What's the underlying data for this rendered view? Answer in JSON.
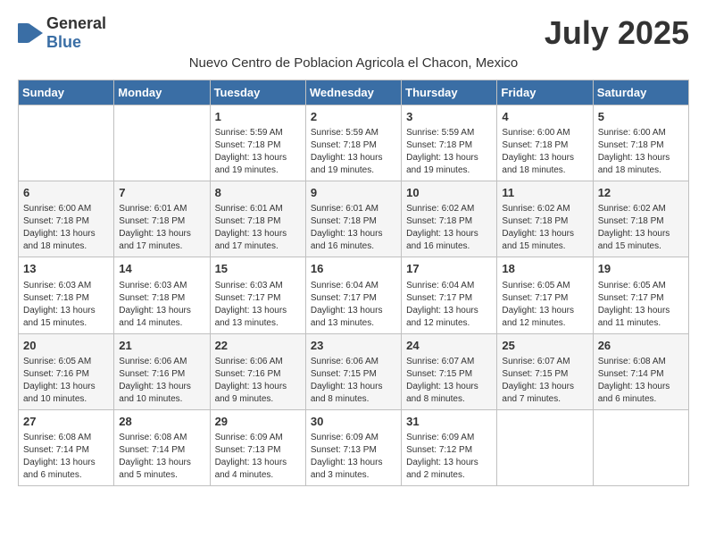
{
  "header": {
    "logo": {
      "general": "General",
      "blue": "Blue"
    },
    "month_title": "July 2025",
    "location": "Nuevo Centro de Poblacion Agricola el Chacon, Mexico"
  },
  "weekdays": [
    "Sunday",
    "Monday",
    "Tuesday",
    "Wednesday",
    "Thursday",
    "Friday",
    "Saturday"
  ],
  "weeks": [
    [
      {
        "day": "",
        "info": ""
      },
      {
        "day": "",
        "info": ""
      },
      {
        "day": "1",
        "info": "Sunrise: 5:59 AM\nSunset: 7:18 PM\nDaylight: 13 hours and 19 minutes."
      },
      {
        "day": "2",
        "info": "Sunrise: 5:59 AM\nSunset: 7:18 PM\nDaylight: 13 hours and 19 minutes."
      },
      {
        "day": "3",
        "info": "Sunrise: 5:59 AM\nSunset: 7:18 PM\nDaylight: 13 hours and 19 minutes."
      },
      {
        "day": "4",
        "info": "Sunrise: 6:00 AM\nSunset: 7:18 PM\nDaylight: 13 hours and 18 minutes."
      },
      {
        "day": "5",
        "info": "Sunrise: 6:00 AM\nSunset: 7:18 PM\nDaylight: 13 hours and 18 minutes."
      }
    ],
    [
      {
        "day": "6",
        "info": "Sunrise: 6:00 AM\nSunset: 7:18 PM\nDaylight: 13 hours and 18 minutes."
      },
      {
        "day": "7",
        "info": "Sunrise: 6:01 AM\nSunset: 7:18 PM\nDaylight: 13 hours and 17 minutes."
      },
      {
        "day": "8",
        "info": "Sunrise: 6:01 AM\nSunset: 7:18 PM\nDaylight: 13 hours and 17 minutes."
      },
      {
        "day": "9",
        "info": "Sunrise: 6:01 AM\nSunset: 7:18 PM\nDaylight: 13 hours and 16 minutes."
      },
      {
        "day": "10",
        "info": "Sunrise: 6:02 AM\nSunset: 7:18 PM\nDaylight: 13 hours and 16 minutes."
      },
      {
        "day": "11",
        "info": "Sunrise: 6:02 AM\nSunset: 7:18 PM\nDaylight: 13 hours and 15 minutes."
      },
      {
        "day": "12",
        "info": "Sunrise: 6:02 AM\nSunset: 7:18 PM\nDaylight: 13 hours and 15 minutes."
      }
    ],
    [
      {
        "day": "13",
        "info": "Sunrise: 6:03 AM\nSunset: 7:18 PM\nDaylight: 13 hours and 15 minutes."
      },
      {
        "day": "14",
        "info": "Sunrise: 6:03 AM\nSunset: 7:18 PM\nDaylight: 13 hours and 14 minutes."
      },
      {
        "day": "15",
        "info": "Sunrise: 6:03 AM\nSunset: 7:17 PM\nDaylight: 13 hours and 13 minutes."
      },
      {
        "day": "16",
        "info": "Sunrise: 6:04 AM\nSunset: 7:17 PM\nDaylight: 13 hours and 13 minutes."
      },
      {
        "day": "17",
        "info": "Sunrise: 6:04 AM\nSunset: 7:17 PM\nDaylight: 13 hours and 12 minutes."
      },
      {
        "day": "18",
        "info": "Sunrise: 6:05 AM\nSunset: 7:17 PM\nDaylight: 13 hours and 12 minutes."
      },
      {
        "day": "19",
        "info": "Sunrise: 6:05 AM\nSunset: 7:17 PM\nDaylight: 13 hours and 11 minutes."
      }
    ],
    [
      {
        "day": "20",
        "info": "Sunrise: 6:05 AM\nSunset: 7:16 PM\nDaylight: 13 hours and 10 minutes."
      },
      {
        "day": "21",
        "info": "Sunrise: 6:06 AM\nSunset: 7:16 PM\nDaylight: 13 hours and 10 minutes."
      },
      {
        "day": "22",
        "info": "Sunrise: 6:06 AM\nSunset: 7:16 PM\nDaylight: 13 hours and 9 minutes."
      },
      {
        "day": "23",
        "info": "Sunrise: 6:06 AM\nSunset: 7:15 PM\nDaylight: 13 hours and 8 minutes."
      },
      {
        "day": "24",
        "info": "Sunrise: 6:07 AM\nSunset: 7:15 PM\nDaylight: 13 hours and 8 minutes."
      },
      {
        "day": "25",
        "info": "Sunrise: 6:07 AM\nSunset: 7:15 PM\nDaylight: 13 hours and 7 minutes."
      },
      {
        "day": "26",
        "info": "Sunrise: 6:08 AM\nSunset: 7:14 PM\nDaylight: 13 hours and 6 minutes."
      }
    ],
    [
      {
        "day": "27",
        "info": "Sunrise: 6:08 AM\nSunset: 7:14 PM\nDaylight: 13 hours and 6 minutes."
      },
      {
        "day": "28",
        "info": "Sunrise: 6:08 AM\nSunset: 7:14 PM\nDaylight: 13 hours and 5 minutes."
      },
      {
        "day": "29",
        "info": "Sunrise: 6:09 AM\nSunset: 7:13 PM\nDaylight: 13 hours and 4 minutes."
      },
      {
        "day": "30",
        "info": "Sunrise: 6:09 AM\nSunset: 7:13 PM\nDaylight: 13 hours and 3 minutes."
      },
      {
        "day": "31",
        "info": "Sunrise: 6:09 AM\nSunset: 7:12 PM\nDaylight: 13 hours and 2 minutes."
      },
      {
        "day": "",
        "info": ""
      },
      {
        "day": "",
        "info": ""
      }
    ]
  ]
}
